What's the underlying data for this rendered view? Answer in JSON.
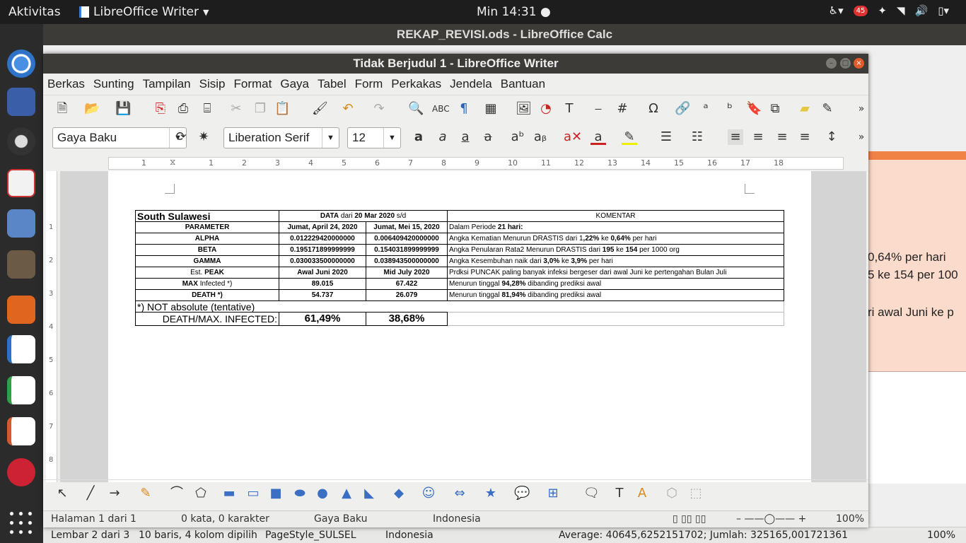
{
  "topbar": {
    "activities": "Aktivitas",
    "app_name": "LibreOffice Writer",
    "clock": "Min 14:31 ●",
    "notif_count": "45"
  },
  "calc": {
    "title": "REKAP_REVISI.ods - LibreOffice Calc",
    "right_cells": [
      "0,64% per hari",
      "5 ke 154 per 100",
      "ri awal Juni ke p"
    ],
    "status": {
      "sheet": "Lembar 2 dari 3",
      "selection": "10 baris, 4 kolom dipilih",
      "pagestyle": "PageStyle_SULSEL",
      "language": "Indonesia",
      "summary": "Average: 40645,6252151702; Jumlah: 325165,001721361",
      "zoom": "100%"
    }
  },
  "writer": {
    "title": "Tidak Berjudul 1 - LibreOffice Writer",
    "menu": [
      "Berkas",
      "Sunting",
      "Tampilan",
      "Sisip",
      "Format",
      "Gaya",
      "Tabel",
      "Form",
      "Perkakas",
      "Jendela",
      "Bantuan"
    ],
    "style_box": "Gaya Baku",
    "font_box": "Liberation Serif",
    "size_box": "12",
    "ruler_numbers": [
      "1",
      "1",
      "2",
      "3",
      "4",
      "5",
      "6",
      "7",
      "8",
      "9",
      "10",
      "11",
      "12",
      "13",
      "14",
      "15",
      "16",
      "17",
      "18"
    ],
    "vruler_numbers": [
      "1",
      "2",
      "3",
      "4",
      "5",
      "6",
      "7",
      "8"
    ],
    "status": {
      "page": "Halaman 1 dari 1",
      "words": "0 kata, 0 karakter",
      "style": "Gaya Baku",
      "language": "Indonesia",
      "zoom": "100%"
    }
  },
  "table": {
    "title": "South Sulawesi",
    "data_header_pre": "DATA",
    "data_header_mid": " dari ",
    "data_header_date": "20 Mar 2020",
    "data_header_post": " s/d",
    "komentar": "KOMENTAR",
    "col_param": "PARAMETER",
    "col1": "Jumat, April 24, 2020",
    "col2": "Jumat, Mei 15, 2020",
    "period_pre": "Dalam Periode ",
    "period_val": "21 hari:",
    "rows": [
      {
        "param": "ALPHA",
        "v1": "0.012229420000000",
        "v2": "0.006409420000000",
        "c_pre": " Angka Kematian Menurun DRASTIS dari 1",
        "c_b1": ",22%",
        "c_mid": " ke ",
        "c_b2": "0,64%",
        "c_post": " per hari"
      },
      {
        "param": "BETA",
        "v1": "0.195171899999999",
        "v2": "0.154031899999999",
        "c_pre": " Angka Penularan Rata2 Menurun DRASTIS dari ",
        "c_b1": "195",
        "c_mid": " ke ",
        "c_b2": "154",
        "c_post": " per 1000 org"
      },
      {
        "param": "GAMMA",
        "v1": "0.030033500000000",
        "v2": "0.038943500000000",
        "c_pre": " Angka Kesembuhan naik dari ",
        "c_b1": "3,0%",
        "c_mid": " ke ",
        "c_b2": "3,9%",
        "c_post": " per hari"
      }
    ],
    "peak_pre": "Est. ",
    "peak_b": "PEAK",
    "peak_v1": "Awal Juni 2020",
    "peak_v2": "Mid July 2020",
    "peak_c": " Prdksi PUNCAK paling banyak infeksi bergeser dari awal Juni ke pertengahan Bulan Juli",
    "max_b": "MAX",
    "max_post": " Infected *)",
    "max_v1": "89.015",
    "max_v2": "67.422",
    "max_c_pre": " Menurun tinggal ",
    "max_c_b": "94,28%",
    "max_c_post": " dibanding prediksi awal",
    "death_label": "DEATH *)",
    "death_v1": "54.737",
    "death_v2": "26.079",
    "death_c_pre": " Menurun tinggal ",
    "death_c_b": "81,94%",
    "death_c_post": " dibanding prediksi awal",
    "note": "*) NOT absolute (tentative)",
    "ratio_label": "DEATH/MAX. INFECTED:",
    "ratio_v1": "61,49%",
    "ratio_v2": "38,68%"
  }
}
